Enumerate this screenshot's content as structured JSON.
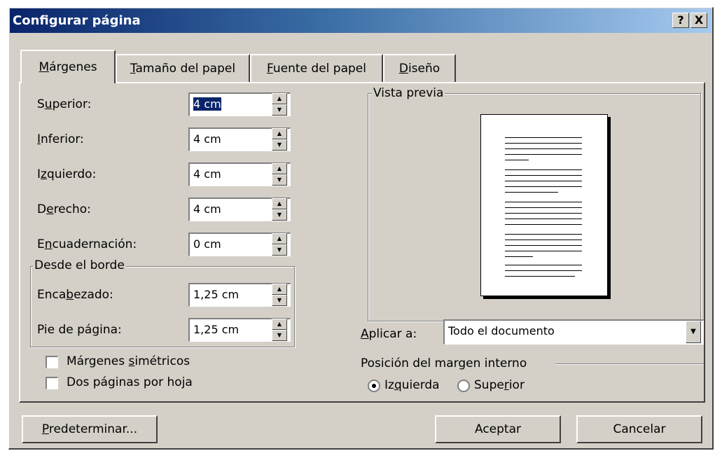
{
  "title": "Configurar página",
  "title_buttons": {
    "help": "?",
    "close": "X"
  },
  "tabs": [
    {
      "pre": "",
      "key": "M",
      "post": "árgenes"
    },
    {
      "pre": "",
      "key": "T",
      "post": "amaño del papel"
    },
    {
      "pre": "",
      "key": "F",
      "post": "uente del papel"
    },
    {
      "pre": "",
      "key": "D",
      "post": "iseño"
    }
  ],
  "margins": [
    {
      "pre": "S",
      "key": "u",
      "post": "perior:",
      "value": "4 cm"
    },
    {
      "pre": "",
      "key": "I",
      "post": "nferior:",
      "value": "4 cm"
    },
    {
      "pre": "I",
      "key": "z",
      "post": "quierdo:",
      "value": "4 cm"
    },
    {
      "pre": "D",
      "key": "e",
      "post": "recho:",
      "value": "4 cm"
    },
    {
      "pre": "E",
      "key": "n",
      "post": "cuadernación:",
      "value": "0 cm"
    }
  ],
  "from_edge": {
    "legend": "Desde el borde",
    "header": {
      "pre": "Enca",
      "key": "b",
      "post": "ezado:",
      "value": "1,25 cm"
    },
    "footer": {
      "pre": "Pie de pá",
      "key": "g",
      "post": "ina:",
      "value": "1,25 cm"
    }
  },
  "checkboxes": [
    {
      "pre": "Márgenes ",
      "key": "s",
      "post": "imétricos",
      "checked": false
    },
    {
      "pre": "Dos páginas por ho",
      "key": "j",
      "post": "a",
      "checked": false
    }
  ],
  "preview": {
    "legend": "Vista previa"
  },
  "apply_to": {
    "pre": "",
    "key": "A",
    "post": "plicar a:",
    "value": "Todo el documento"
  },
  "gutter_position": {
    "legend": "Posición del margen interno",
    "options": [
      {
        "pre": "Iz",
        "key": "q",
        "post": "uierda",
        "selected": true
      },
      {
        "pre": "Supe",
        "key": "r",
        "post": "ior",
        "selected": false
      }
    ]
  },
  "buttons": {
    "default": {
      "pre": "",
      "key": "P",
      "post": "redeterminar..."
    },
    "ok": "Aceptar",
    "cancel": "Cancelar"
  },
  "colors": {
    "face": "#d4d0c8",
    "title_start": "#0a246a",
    "title_end": "#a6caf0",
    "selection": "#0a246a"
  }
}
